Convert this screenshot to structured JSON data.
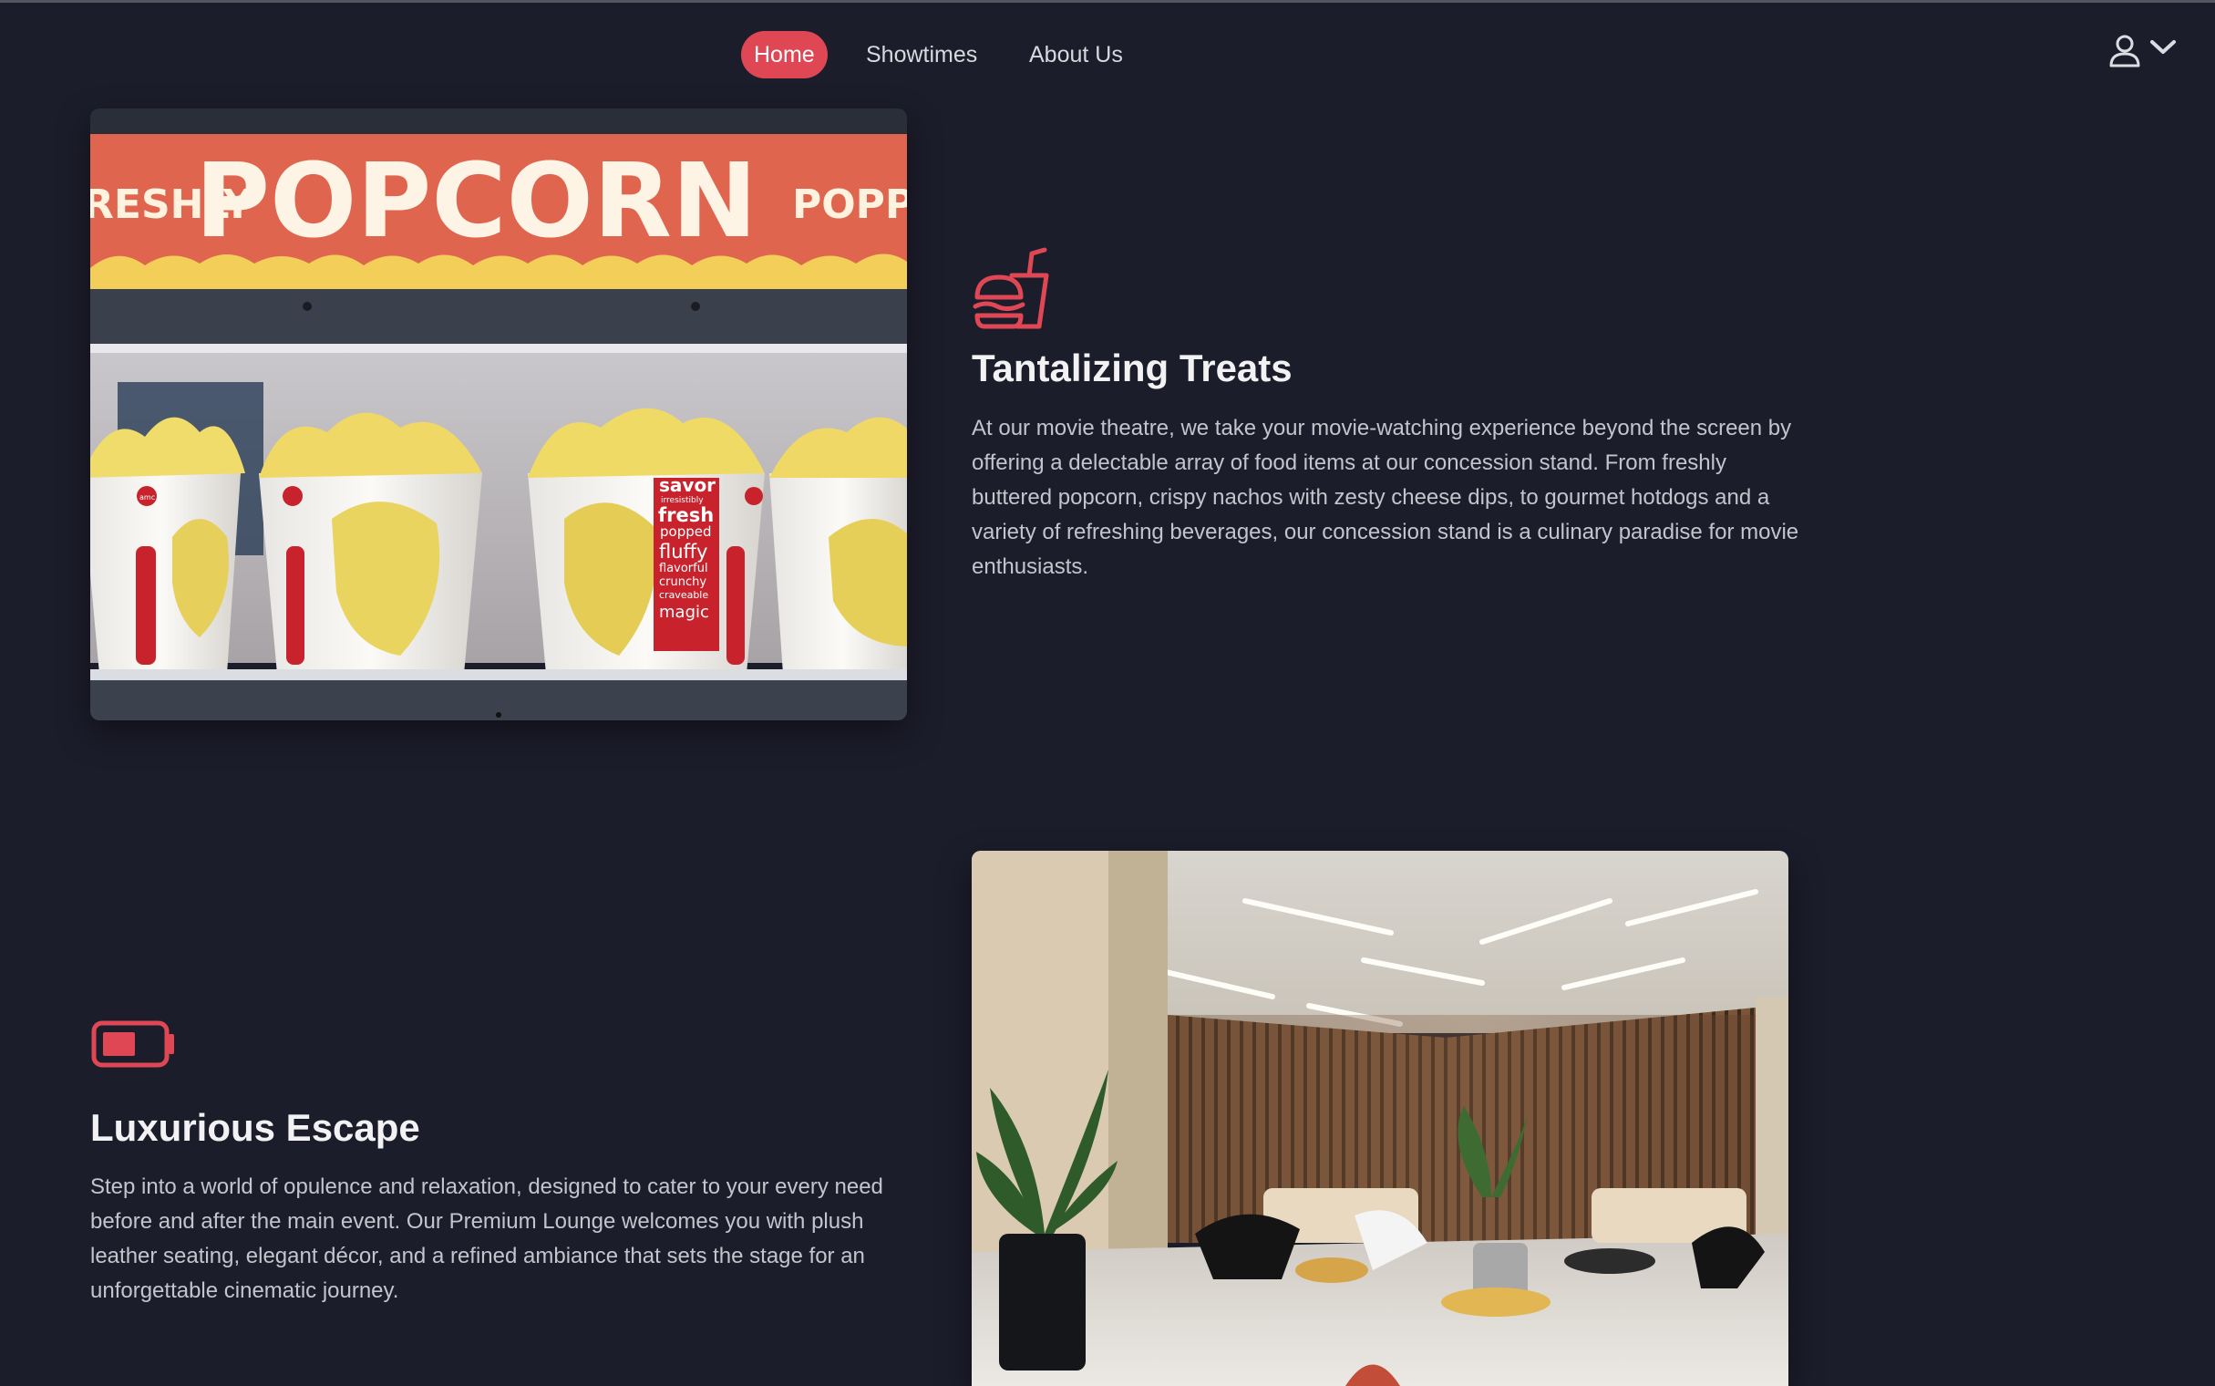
{
  "nav": {
    "items": [
      {
        "label": "Home",
        "active": true
      },
      {
        "label": "Showtimes",
        "active": false
      },
      {
        "label": "About Us",
        "active": false
      }
    ],
    "user_icon": "user-icon",
    "dropdown_icon": "chevron-down-icon"
  },
  "sections": {
    "treats": {
      "icon": "burger-drink-icon",
      "title": "Tantalizing Treats",
      "body": "At our movie theatre, we take your movie-watching experience beyond the screen by offering a delectable array of food items at our concession stand. From freshly buttered popcorn, crispy nachos with zesty cheese dips, to gourmet hotdogs and a variety of refreshing beverages, our concession stand is a culinary paradise for movie enthusiasts.",
      "image": {
        "banner_left": "RESHLY",
        "banner_main": "POPCORN",
        "banner_right": "POPPE",
        "cup_badge": "amc",
        "cup_text": [
          "savor",
          "irresistibly",
          "fresh",
          "popped",
          "fluffy",
          "flavorful",
          "crunchy",
          "craveable",
          "magic"
        ]
      }
    },
    "lounge": {
      "icon": "battery-icon",
      "title": "Luxurious Escape",
      "body": "Step into a world of opulence and relaxation, designed to cater to your every need before and after the main event. Our Premium Lounge welcomes you with plush leather seating, elegant décor, and a refined ambiance that sets the stage for an unforgettable cinematic journey."
    }
  },
  "colors": {
    "background": "#1c1d2b",
    "accent": "#e04755",
    "text": "#c3c5cd",
    "heading": "#f2f2f4"
  }
}
